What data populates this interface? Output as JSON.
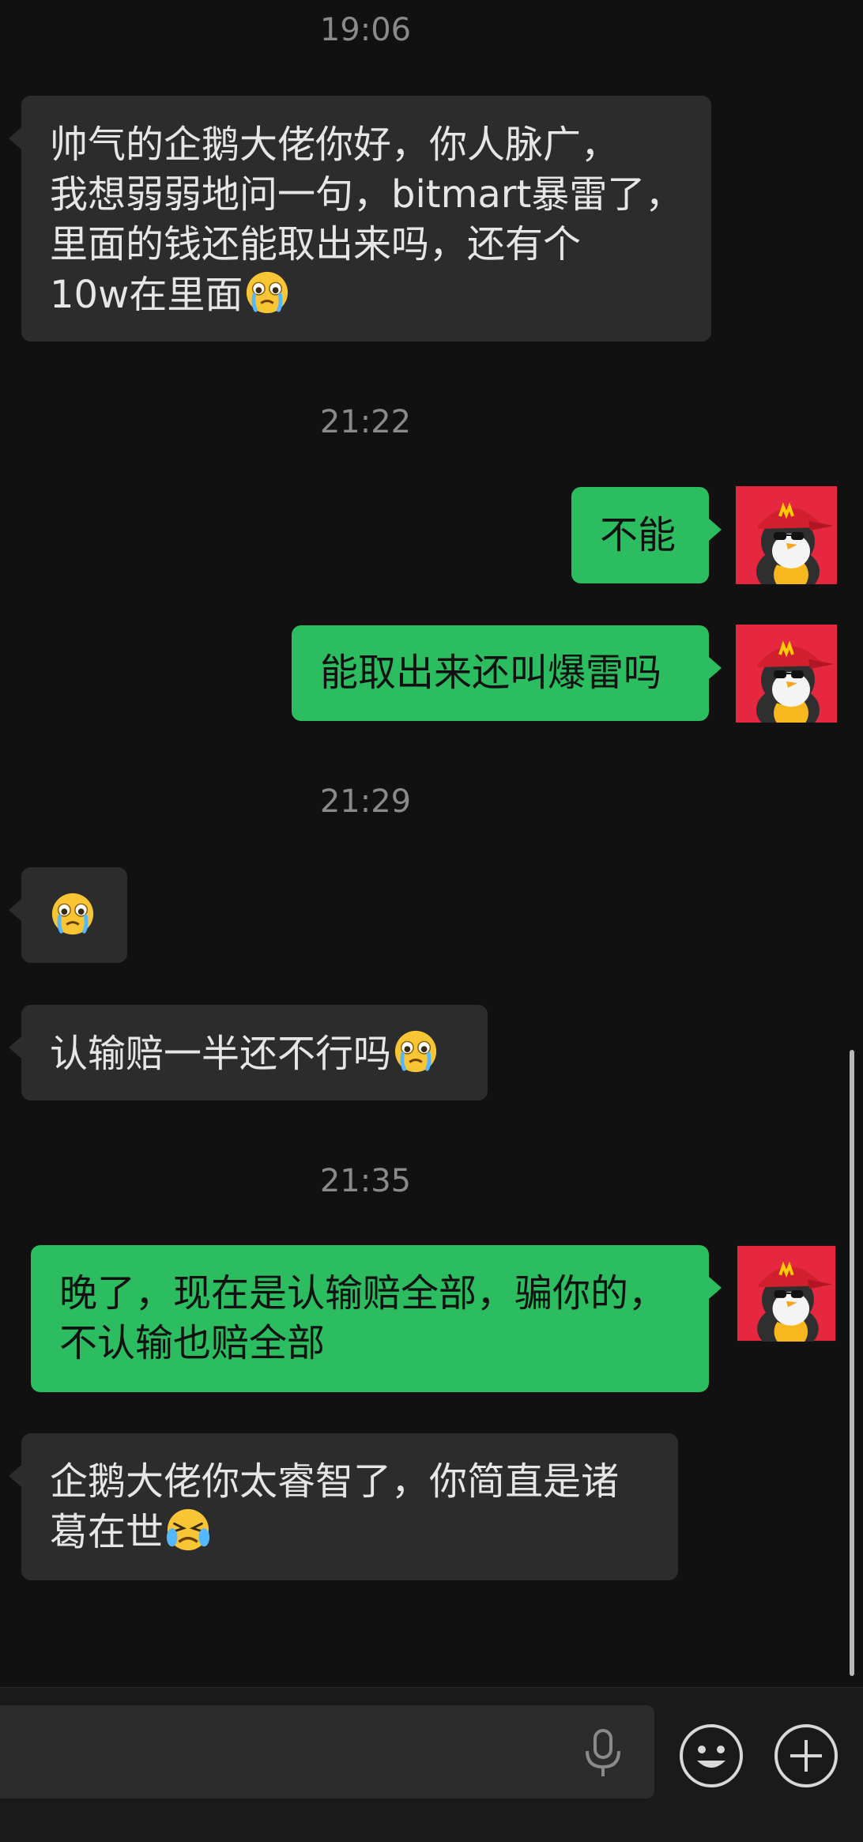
{
  "timestamps": [
    "19:06",
    "21:22",
    "21:29",
    "21:35"
  ],
  "messages": [
    {
      "side": "in",
      "lines": [
        "帅气的企鹅大佬你好，你人脉广，",
        "我想弱弱地问一句，bitmart暴雷了，",
        "里面的钱还能取出来吗，还有个",
        "10w在里面"
      ],
      "emoji": "crying-face"
    },
    {
      "side": "out",
      "lines": [
        "不能"
      ]
    },
    {
      "side": "out",
      "lines": [
        "能取出来还叫爆雷吗"
      ]
    },
    {
      "side": "in",
      "lines": [
        ""
      ],
      "emoji": "crying-face"
    },
    {
      "side": "in",
      "lines": [
        "认输赔一半还不行吗"
      ],
      "emoji": "crying-face"
    },
    {
      "side": "out",
      "lines": [
        "晚了，现在是认输赔全部，骗你的，",
        "不认输也赔全部"
      ]
    },
    {
      "side": "in",
      "lines": [
        "企鹅大佬你太睿智了，你简直是诸",
        "葛在世"
      ],
      "emoji": "sobbing-face"
    }
  ],
  "avatar": {
    "icon": "penguin-mcdonalds-cap-avatar",
    "background": "#e5273f"
  },
  "colors": {
    "background": "#111111",
    "incoming": "#2c2c2c",
    "outgoing": "#2bbd5f",
    "timestamp": "#8a8a8a"
  },
  "input_bar": {
    "text": "",
    "icons": [
      "microphone-icon",
      "emoji-icon",
      "plus-icon"
    ]
  }
}
